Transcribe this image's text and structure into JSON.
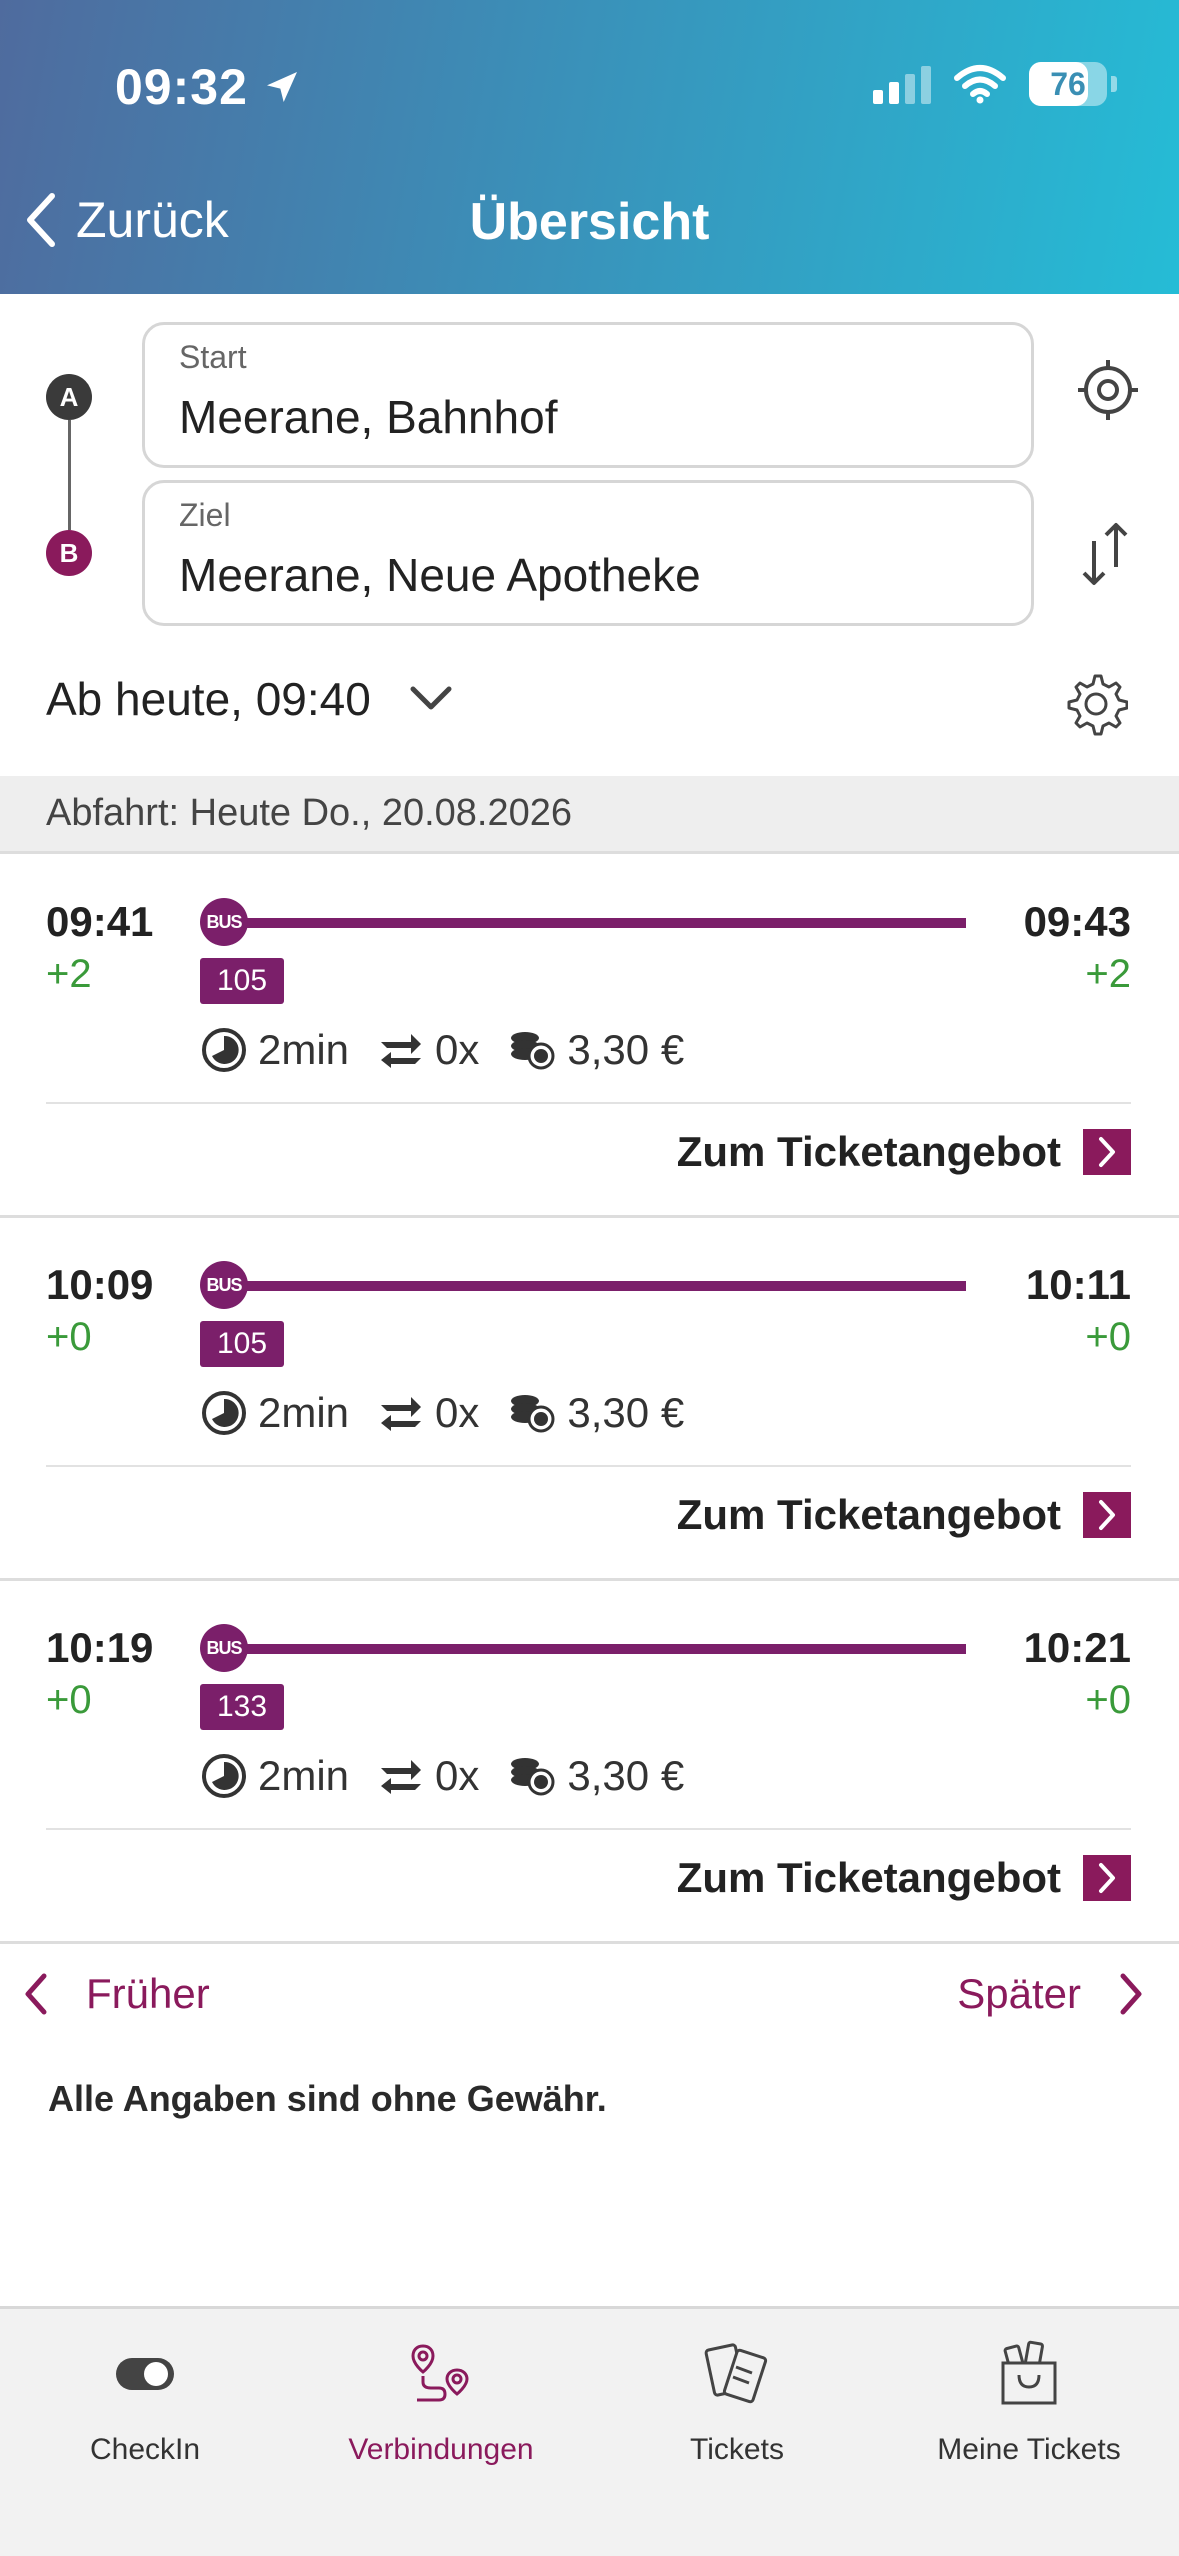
{
  "status_bar": {
    "time": "09:32",
    "battery": "76"
  },
  "nav": {
    "back_label": "Zurück",
    "title": "Übersicht"
  },
  "search": {
    "start_label": "Start",
    "start_value": "Meerane, Bahnhof",
    "ziel_label": "Ziel",
    "ziel_value": "Meerane, Neue Apotheke",
    "marker_a": "A",
    "marker_b": "B",
    "time_selector": "Ab heute, 09:40"
  },
  "date_header": "Abfahrt: Heute Do., 20.08.2026",
  "connections": [
    {
      "dep": "09:41",
      "dep_delay": "+2",
      "arr": "09:43",
      "arr_delay": "+2",
      "mode": "BUS",
      "line": "105",
      "duration": "2min",
      "changes": "0x",
      "price": "3,30 €",
      "ticket_label": "Zum Ticketangebot"
    },
    {
      "dep": "10:09",
      "dep_delay": "+0",
      "arr": "10:11",
      "arr_delay": "+0",
      "mode": "BUS",
      "line": "105",
      "duration": "2min",
      "changes": "0x",
      "price": "3,30 €",
      "ticket_label": "Zum Ticketangebot"
    },
    {
      "dep": "10:19",
      "dep_delay": "+0",
      "arr": "10:21",
      "arr_delay": "+0",
      "mode": "BUS",
      "line": "133",
      "duration": "2min",
      "changes": "0x",
      "price": "3,30 €",
      "ticket_label": "Zum Ticketangebot"
    }
  ],
  "pager": {
    "earlier": "Früher",
    "later": "Später"
  },
  "disclaimer": "Alle Angaben sind ohne Gewähr.",
  "tabs": [
    {
      "label": "CheckIn",
      "icon": "toggle-icon"
    },
    {
      "label": "Verbindungen",
      "icon": "route-icon",
      "active": true
    },
    {
      "label": "Tickets",
      "icon": "tickets-icon"
    },
    {
      "label": "Meine Tickets",
      "icon": "shopping-bag-icon"
    }
  ],
  "colors": {
    "accent": "#8a1a5c",
    "line": "#7b1f6a",
    "delay": "#3a9a3a"
  }
}
